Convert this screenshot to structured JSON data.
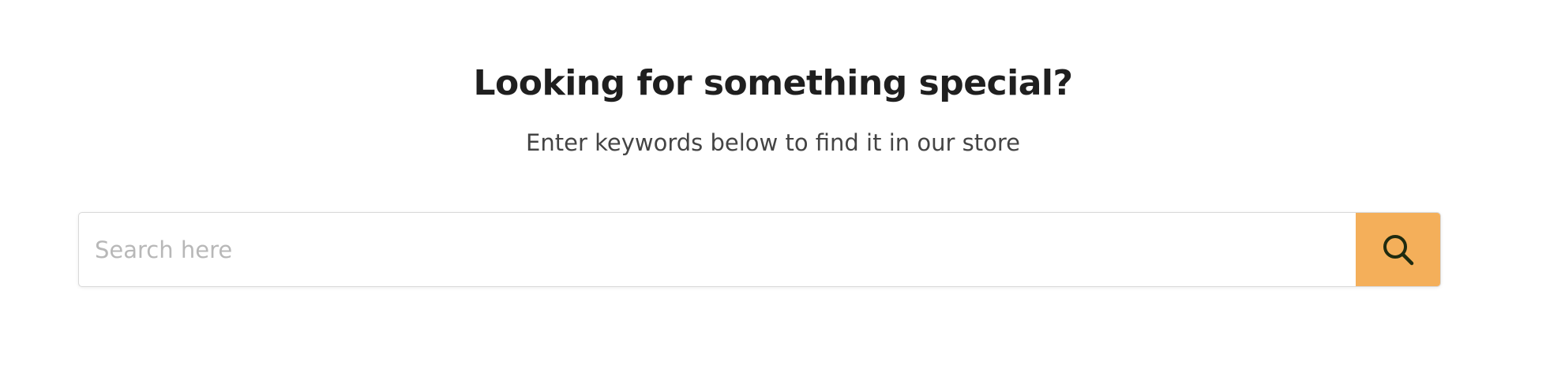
{
  "hero": {
    "title": "Looking for something special?",
    "subtitle": "Enter keywords below to find it in our store"
  },
  "search": {
    "value": "",
    "placeholder": "Search here",
    "button_icon": "search-icon"
  },
  "colors": {
    "accent": "#f4af5a",
    "icon": "#1f2b10",
    "placeholder": "#b8b8b8"
  }
}
